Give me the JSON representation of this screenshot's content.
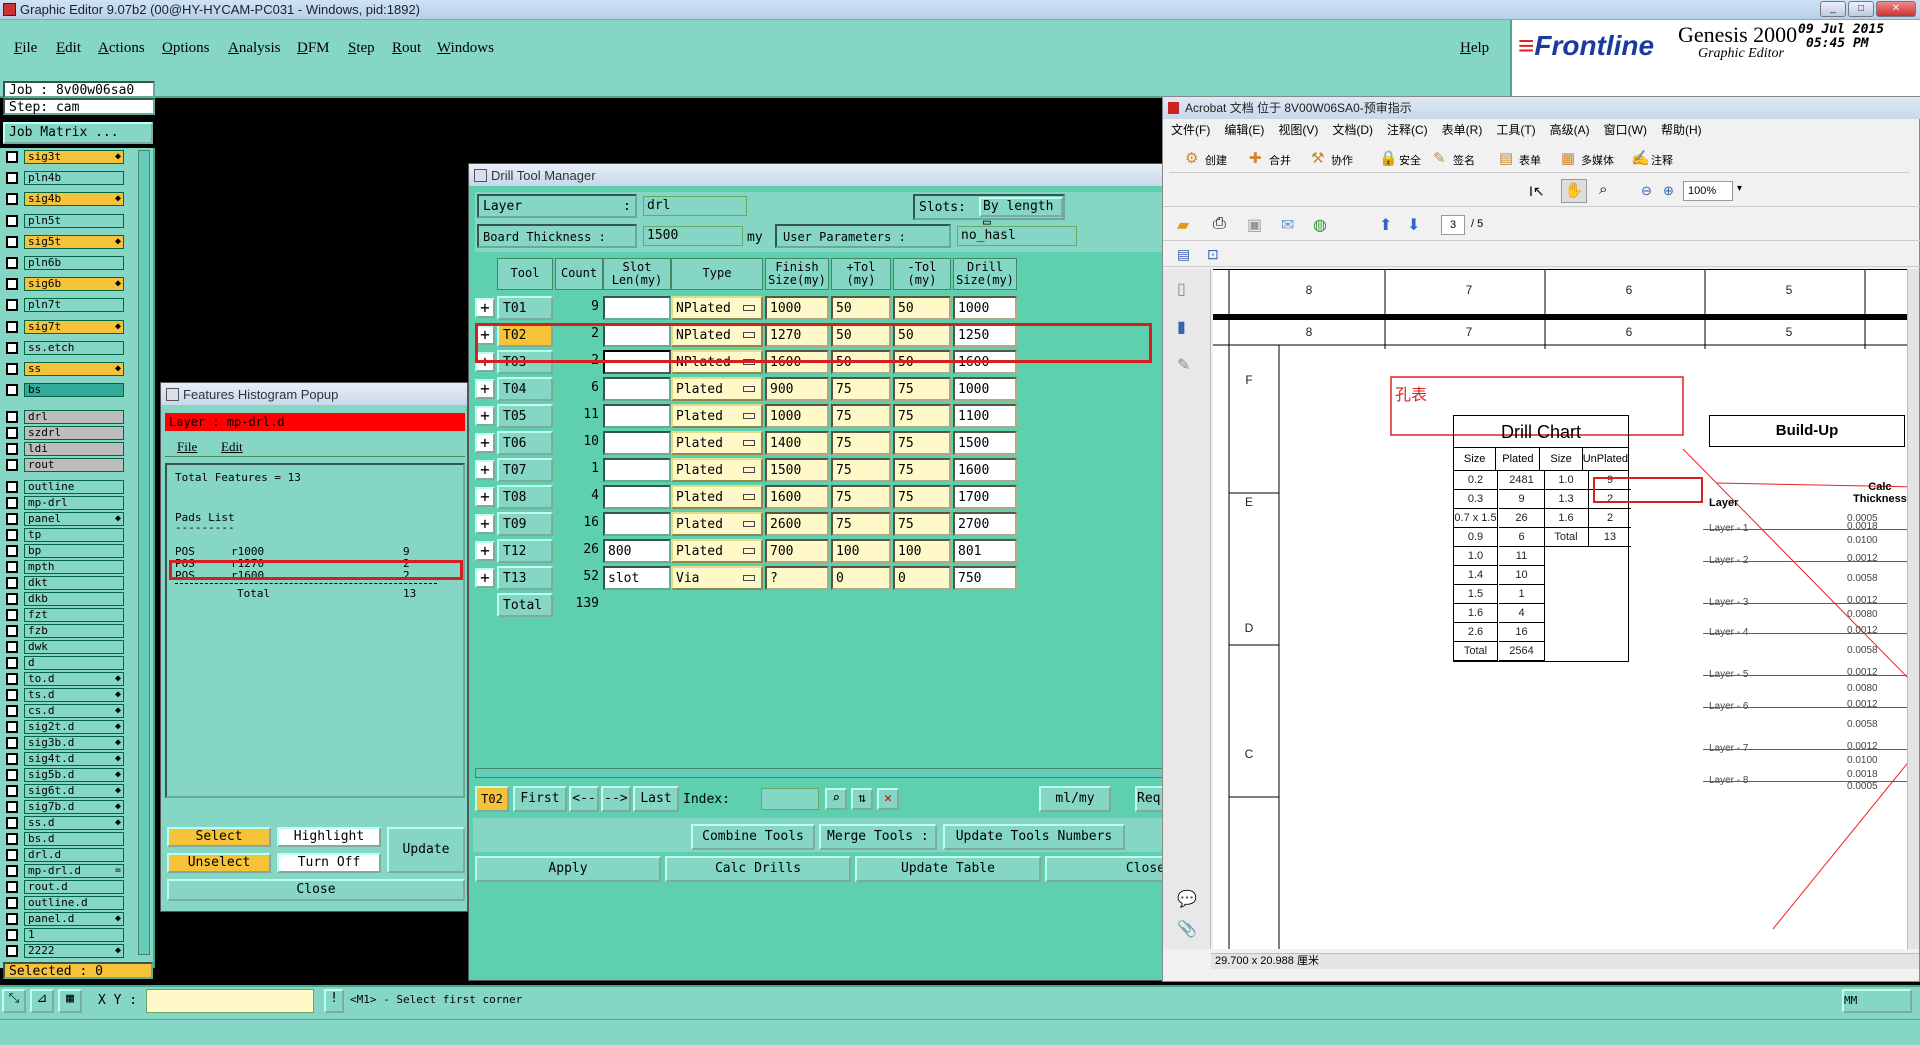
{
  "window": {
    "title": "Graphic Editor 9.07b2 (00@HY-HYCAM-PC031 - Windows, pid:1892)"
  },
  "menu": [
    "File",
    "Edit",
    "Actions",
    "Options",
    "Analysis",
    "DFM",
    "Step",
    "Rout",
    "Windows"
  ],
  "help": "Help",
  "logo": {
    "brand": "Frontline",
    "product": "Genesis 2000",
    "sub": "Graphic Editor",
    "date": "09 Jul 2015",
    "time": "05:45 PM"
  },
  "job": {
    "job_line": "Job : 8v00w06sa0",
    "step_line": "Step: cam",
    "matrix_btn": "Job Matrix ..."
  },
  "layers": [
    {
      "n": "sig3t",
      "c": "y",
      "a": "◆"
    },
    {
      "n": "pln4b",
      "c": ""
    },
    {
      "n": "sig4b",
      "c": "y",
      "a": "◆"
    },
    {
      "n": "pln5t",
      "c": ""
    },
    {
      "n": "sig5t",
      "c": "y",
      "a": "◆"
    },
    {
      "n": "pln6b",
      "c": ""
    },
    {
      "n": "sig6b",
      "c": "y",
      "a": "◆"
    },
    {
      "n": "pln7t",
      "c": ""
    },
    {
      "n": "sig7t",
      "c": "y",
      "a": "◆"
    },
    {
      "n": "ss.etch",
      "c": ""
    },
    {
      "n": "ss",
      "c": "y",
      "a": "◆"
    },
    {
      "n": "bs",
      "c": "g"
    },
    {
      "n": "drl",
      "c": "gy"
    },
    {
      "n": "szdrl",
      "c": "gy"
    },
    {
      "n": "ldi",
      "c": "gy"
    },
    {
      "n": "rout",
      "c": "gy"
    },
    {
      "n": "outline",
      "c": ""
    },
    {
      "n": "mp-drl",
      "c": ""
    },
    {
      "n": "panel",
      "c": "",
      "a": "◆"
    },
    {
      "n": "tp",
      "c": ""
    },
    {
      "n": "bp",
      "c": ""
    },
    {
      "n": "mpth",
      "c": ""
    },
    {
      "n": "dkt",
      "c": ""
    },
    {
      "n": "dkb",
      "c": ""
    },
    {
      "n": "fzt",
      "c": ""
    },
    {
      "n": "fzb",
      "c": ""
    },
    {
      "n": "dwk",
      "c": ""
    },
    {
      "n": "d",
      "c": ""
    },
    {
      "n": "to.d",
      "c": "",
      "a": "◆"
    },
    {
      "n": "ts.d",
      "c": "",
      "a": "◆"
    },
    {
      "n": "cs.d",
      "c": "",
      "a": "◆"
    },
    {
      "n": "sig2t.d",
      "c": "",
      "a": "◆"
    },
    {
      "n": "sig3b.d",
      "c": "",
      "a": "◆"
    },
    {
      "n": "sig4t.d",
      "c": "",
      "a": "◆"
    },
    {
      "n": "sig5b.d",
      "c": "",
      "a": "◆"
    },
    {
      "n": "sig6t.d",
      "c": "",
      "a": "◆"
    },
    {
      "n": "sig7b.d",
      "c": "",
      "a": "◆"
    },
    {
      "n": "ss.d",
      "c": "",
      "a": "◆"
    },
    {
      "n": "bs.d",
      "c": ""
    },
    {
      "n": "drl.d",
      "c": ""
    },
    {
      "n": "mp-drl.d",
      "c": "",
      "a": "="
    },
    {
      "n": "rout.d",
      "c": ""
    },
    {
      "n": "outline.d",
      "c": ""
    },
    {
      "n": "panel.d",
      "c": "",
      "a": "◆"
    },
    {
      "n": "1",
      "c": ""
    },
    {
      "n": "2222",
      "c": "",
      "a": "◆"
    }
  ],
  "selected": "Selected : 0",
  "histogram": {
    "title": "Features Histogram Popup",
    "layer": "Layer : mp-drl.d",
    "menu": [
      "File",
      "Edit"
    ],
    "total": "Total Features = 13",
    "pads_title": "Pads List",
    "pads_rule": "---------",
    "rows": [
      [
        "POS",
        "r1000",
        "9"
      ],
      [
        "POS",
        "r1270",
        "2"
      ],
      [
        "POS",
        "r1600",
        "2"
      ]
    ],
    "total_label": "Total",
    "total_value": "13",
    "buttons": {
      "select": "Select",
      "highlight": "Highlight",
      "update": "Update",
      "unselect": "Unselect",
      "turnoff": "Turn Off",
      "close": "Close"
    }
  },
  "dtm": {
    "title": "Drill Tool Manager",
    "layer_label": "Layer",
    "layer_value": "drl",
    "slots_label": "Slots:",
    "slots_value": "By length",
    "bt_label": "Board Thickness :",
    "bt_value": "1500",
    "bt_unit": "my",
    "up_label": "User Parameters :",
    "up_value": "no_hasl",
    "headers": [
      "Tool",
      "Count",
      "Slot\nLen(my)",
      "Type",
      "Finish\nSize(my)",
      "+Tol\n(my)",
      "-Tol\n(my)",
      "Drill\nSize(my)"
    ],
    "rows": [
      [
        "T01",
        "9",
        "",
        "NPlated",
        "1000",
        "50",
        "50",
        "1000"
      ],
      [
        "T02",
        "2",
        "",
        "NPlated",
        "1270",
        "50",
        "50",
        "1250"
      ],
      [
        "T03",
        "2",
        "",
        "NPlated",
        "1600",
        "50",
        "50",
        "1600"
      ],
      [
        "T04",
        "6",
        "",
        "Plated",
        "900",
        "75",
        "75",
        "1000"
      ],
      [
        "T05",
        "11",
        "",
        "Plated",
        "1000",
        "75",
        "75",
        "1100"
      ],
      [
        "T06",
        "10",
        "",
        "Plated",
        "1400",
        "75",
        "75",
        "1500"
      ],
      [
        "T07",
        "1",
        "",
        "Plated",
        "1500",
        "75",
        "75",
        "1600"
      ],
      [
        "T08",
        "4",
        "",
        "Plated",
        "1600",
        "75",
        "75",
        "1700"
      ],
      [
        "T09",
        "16",
        "",
        "Plated",
        "2600",
        "75",
        "75",
        "2700"
      ],
      [
        "T12",
        "26",
        "800",
        "Plated",
        "700",
        "100",
        "100",
        "801"
      ],
      [
        "T13",
        "52",
        "slot",
        "Via",
        "?",
        "0",
        "0",
        "750"
      ]
    ],
    "total_label": "Total",
    "total_value": "139",
    "nav": {
      "current": "T02",
      "first": "First",
      "prev": "<--",
      "next": "-->",
      "last": "Last",
      "index": "Index:",
      "units": "ml/my",
      "req": "Req"
    },
    "buttons": {
      "combine": "Combine Tools",
      "merge": "Merge Tools :",
      "update_nums": "Update Tools Numbers",
      "apply": "Apply",
      "calc": "Calc Drills",
      "update_table": "Update Table",
      "close": "Close"
    }
  },
  "acrobat": {
    "title": "Acrobat 文档 位于 8V00W06SA0-预审指示",
    "menu": [
      "文件(F)",
      "编辑(E)",
      "视图(V)",
      "文档(D)",
      "注释(C)",
      "表单(R)",
      "工具(T)",
      "高级(A)",
      "窗口(W)",
      "帮助(H)"
    ],
    "toolbar": [
      "创建",
      "合并",
      "协作",
      "安全",
      "签名",
      "表单",
      "多媒体",
      "注释"
    ],
    "zoom": "100%",
    "page": "3",
    "pages": "/ 5",
    "ruler": [
      "8",
      "7",
      "6",
      "5"
    ],
    "rowlabels": [
      "F",
      "E",
      "D",
      "C"
    ],
    "note": "孔表",
    "drill_chart": {
      "title": "Drill Chart",
      "headers": [
        "Size",
        "Plated",
        "Size",
        "UnPlated"
      ],
      "plated": [
        [
          "0.2",
          "2481"
        ],
        [
          "0.3",
          "9"
        ],
        [
          "0.7 x 1.5",
          "26"
        ],
        [
          "0.9",
          "6"
        ],
        [
          "1.0",
          "11"
        ],
        [
          "1.4",
          "10"
        ],
        [
          "1.5",
          "1"
        ],
        [
          "1.6",
          "4"
        ],
        [
          "2.6",
          "16"
        ],
        [
          "Total",
          "2564"
        ]
      ],
      "unplated": [
        [
          "1.0",
          "9"
        ],
        [
          "1.3",
          "2"
        ],
        [
          "1.6",
          "2"
        ],
        [
          "Total",
          "13"
        ]
      ]
    },
    "buildup": {
      "title": "Build-Up",
      "layer_hdr": "Layer",
      "calc_hdr": "Calc\nThickness",
      "layers": [
        "Layer - 1",
        "Layer - 2",
        "Layer - 3",
        "Layer - 4",
        "Layer - 5",
        "Layer - 6",
        "Layer - 7",
        "Layer - 8"
      ],
      "values": [
        "0.0005",
        "0.0018",
        "0.0100",
        "0.0012",
        "0.0058",
        "0.0012",
        "0.0080",
        "0.0012",
        "0.0058",
        "0.0012",
        "0.0080",
        "0.0012",
        "0.0058",
        "0.0012",
        "0.0100",
        "0.0018",
        "0.0005"
      ]
    },
    "status": "29.700 x 20.988 厘米"
  },
  "bottom": {
    "xy_label": "X Y :",
    "prompt": "<M1> - Select first corner",
    "unit": "MM"
  }
}
